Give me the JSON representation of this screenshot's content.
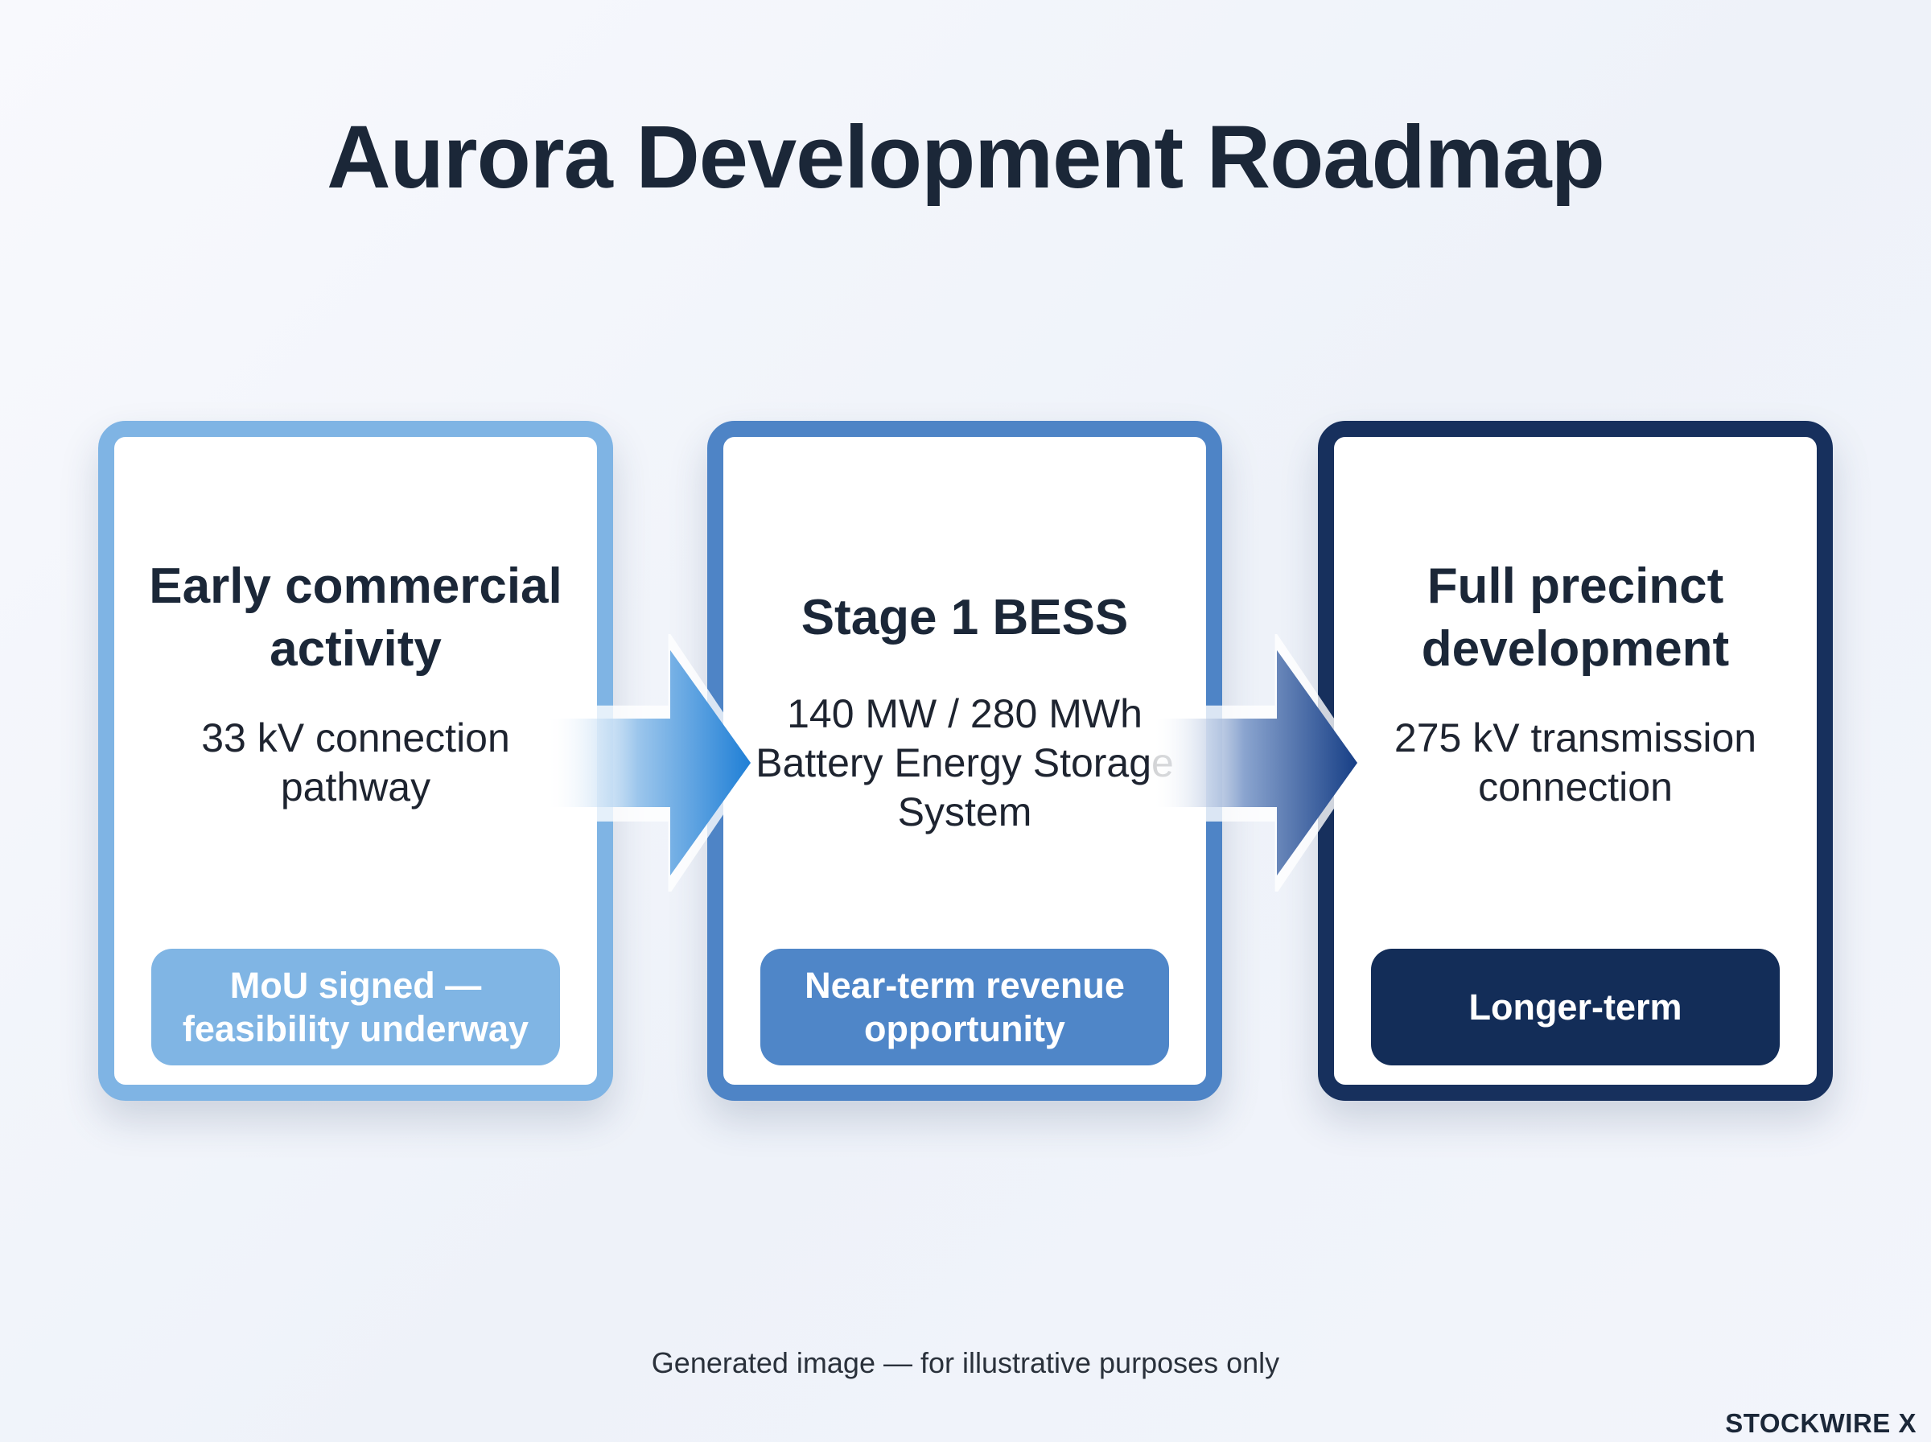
{
  "title": "Aurora Development Roadmap",
  "stages": [
    {
      "title": "Early commercial activity",
      "description": "33 kV connection pathway",
      "status": "MoU signed — feasibility underway"
    },
    {
      "title": "Stage 1 BESS",
      "description": "140 MW / 280 MWh Battery Energy Storage System",
      "status": "Near-term revenue opportunity"
    },
    {
      "title": "Full precinct development",
      "description": "275 kV transmission connection",
      "status": "Longer-term"
    }
  ],
  "colors": {
    "stage1": "#7fb4e4",
    "stage2": "#4e84c6",
    "stage3": "#17305d",
    "arrow1": "#1f7fd6",
    "arrow2": "#173f86"
  },
  "footer_note": "Generated image — for illustrative purposes only",
  "brand": "STOCKWIRE X"
}
